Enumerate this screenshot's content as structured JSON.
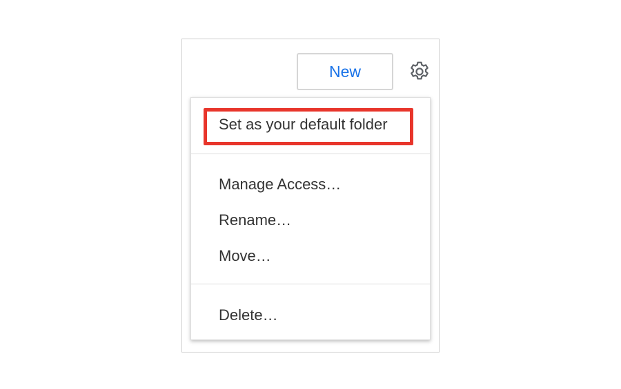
{
  "toolbar": {
    "new_label": "New",
    "settings_icon": "gear-icon"
  },
  "menu": {
    "highlight_color": "#e8352b",
    "items": [
      {
        "label": "Set as your default folder"
      },
      {
        "label": "Manage Access…"
      },
      {
        "label": "Rename…"
      },
      {
        "label": "Move…"
      },
      {
        "label": "Delete…"
      }
    ]
  },
  "colors": {
    "accent": "#1a73e8",
    "text": "#333333"
  }
}
